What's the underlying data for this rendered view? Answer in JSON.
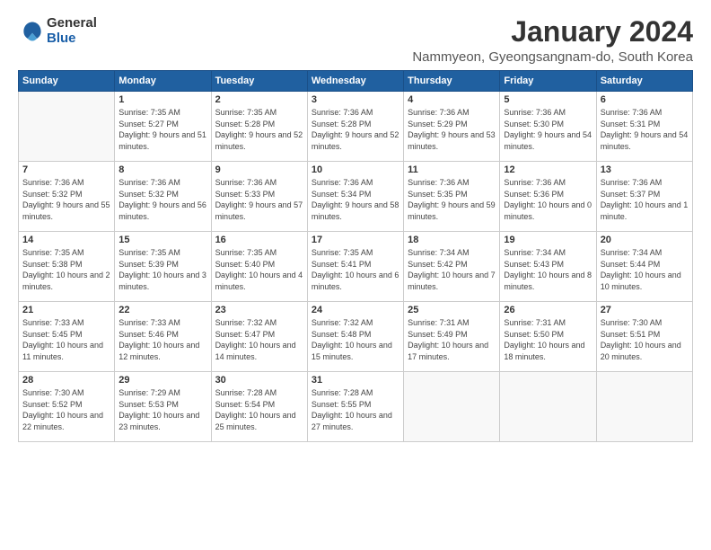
{
  "logo": {
    "general": "General",
    "blue": "Blue"
  },
  "title": "January 2024",
  "location": "Nammyeon, Gyeongsangnam-do, South Korea",
  "days_of_week": [
    "Sunday",
    "Monday",
    "Tuesday",
    "Wednesday",
    "Thursday",
    "Friday",
    "Saturday"
  ],
  "weeks": [
    [
      {
        "day": "",
        "sunrise": "",
        "sunset": "",
        "daylight": ""
      },
      {
        "day": "1",
        "sunrise": "Sunrise: 7:35 AM",
        "sunset": "Sunset: 5:27 PM",
        "daylight": "Daylight: 9 hours and 51 minutes."
      },
      {
        "day": "2",
        "sunrise": "Sunrise: 7:35 AM",
        "sunset": "Sunset: 5:28 PM",
        "daylight": "Daylight: 9 hours and 52 minutes."
      },
      {
        "day": "3",
        "sunrise": "Sunrise: 7:36 AM",
        "sunset": "Sunset: 5:28 PM",
        "daylight": "Daylight: 9 hours and 52 minutes."
      },
      {
        "day": "4",
        "sunrise": "Sunrise: 7:36 AM",
        "sunset": "Sunset: 5:29 PM",
        "daylight": "Daylight: 9 hours and 53 minutes."
      },
      {
        "day": "5",
        "sunrise": "Sunrise: 7:36 AM",
        "sunset": "Sunset: 5:30 PM",
        "daylight": "Daylight: 9 hours and 54 minutes."
      },
      {
        "day": "6",
        "sunrise": "Sunrise: 7:36 AM",
        "sunset": "Sunset: 5:31 PM",
        "daylight": "Daylight: 9 hours and 54 minutes."
      }
    ],
    [
      {
        "day": "7",
        "sunrise": "Sunrise: 7:36 AM",
        "sunset": "Sunset: 5:32 PM",
        "daylight": "Daylight: 9 hours and 55 minutes."
      },
      {
        "day": "8",
        "sunrise": "Sunrise: 7:36 AM",
        "sunset": "Sunset: 5:32 PM",
        "daylight": "Daylight: 9 hours and 56 minutes."
      },
      {
        "day": "9",
        "sunrise": "Sunrise: 7:36 AM",
        "sunset": "Sunset: 5:33 PM",
        "daylight": "Daylight: 9 hours and 57 minutes."
      },
      {
        "day": "10",
        "sunrise": "Sunrise: 7:36 AM",
        "sunset": "Sunset: 5:34 PM",
        "daylight": "Daylight: 9 hours and 58 minutes."
      },
      {
        "day": "11",
        "sunrise": "Sunrise: 7:36 AM",
        "sunset": "Sunset: 5:35 PM",
        "daylight": "Daylight: 9 hours and 59 minutes."
      },
      {
        "day": "12",
        "sunrise": "Sunrise: 7:36 AM",
        "sunset": "Sunset: 5:36 PM",
        "daylight": "Daylight: 10 hours and 0 minutes."
      },
      {
        "day": "13",
        "sunrise": "Sunrise: 7:36 AM",
        "sunset": "Sunset: 5:37 PM",
        "daylight": "Daylight: 10 hours and 1 minute."
      }
    ],
    [
      {
        "day": "14",
        "sunrise": "Sunrise: 7:35 AM",
        "sunset": "Sunset: 5:38 PM",
        "daylight": "Daylight: 10 hours and 2 minutes."
      },
      {
        "day": "15",
        "sunrise": "Sunrise: 7:35 AM",
        "sunset": "Sunset: 5:39 PM",
        "daylight": "Daylight: 10 hours and 3 minutes."
      },
      {
        "day": "16",
        "sunrise": "Sunrise: 7:35 AM",
        "sunset": "Sunset: 5:40 PM",
        "daylight": "Daylight: 10 hours and 4 minutes."
      },
      {
        "day": "17",
        "sunrise": "Sunrise: 7:35 AM",
        "sunset": "Sunset: 5:41 PM",
        "daylight": "Daylight: 10 hours and 6 minutes."
      },
      {
        "day": "18",
        "sunrise": "Sunrise: 7:34 AM",
        "sunset": "Sunset: 5:42 PM",
        "daylight": "Daylight: 10 hours and 7 minutes."
      },
      {
        "day": "19",
        "sunrise": "Sunrise: 7:34 AM",
        "sunset": "Sunset: 5:43 PM",
        "daylight": "Daylight: 10 hours and 8 minutes."
      },
      {
        "day": "20",
        "sunrise": "Sunrise: 7:34 AM",
        "sunset": "Sunset: 5:44 PM",
        "daylight": "Daylight: 10 hours and 10 minutes."
      }
    ],
    [
      {
        "day": "21",
        "sunrise": "Sunrise: 7:33 AM",
        "sunset": "Sunset: 5:45 PM",
        "daylight": "Daylight: 10 hours and 11 minutes."
      },
      {
        "day": "22",
        "sunrise": "Sunrise: 7:33 AM",
        "sunset": "Sunset: 5:46 PM",
        "daylight": "Daylight: 10 hours and 12 minutes."
      },
      {
        "day": "23",
        "sunrise": "Sunrise: 7:32 AM",
        "sunset": "Sunset: 5:47 PM",
        "daylight": "Daylight: 10 hours and 14 minutes."
      },
      {
        "day": "24",
        "sunrise": "Sunrise: 7:32 AM",
        "sunset": "Sunset: 5:48 PM",
        "daylight": "Daylight: 10 hours and 15 minutes."
      },
      {
        "day": "25",
        "sunrise": "Sunrise: 7:31 AM",
        "sunset": "Sunset: 5:49 PM",
        "daylight": "Daylight: 10 hours and 17 minutes."
      },
      {
        "day": "26",
        "sunrise": "Sunrise: 7:31 AM",
        "sunset": "Sunset: 5:50 PM",
        "daylight": "Daylight: 10 hours and 18 minutes."
      },
      {
        "day": "27",
        "sunrise": "Sunrise: 7:30 AM",
        "sunset": "Sunset: 5:51 PM",
        "daylight": "Daylight: 10 hours and 20 minutes."
      }
    ],
    [
      {
        "day": "28",
        "sunrise": "Sunrise: 7:30 AM",
        "sunset": "Sunset: 5:52 PM",
        "daylight": "Daylight: 10 hours and 22 minutes."
      },
      {
        "day": "29",
        "sunrise": "Sunrise: 7:29 AM",
        "sunset": "Sunset: 5:53 PM",
        "daylight": "Daylight: 10 hours and 23 minutes."
      },
      {
        "day": "30",
        "sunrise": "Sunrise: 7:28 AM",
        "sunset": "Sunset: 5:54 PM",
        "daylight": "Daylight: 10 hours and 25 minutes."
      },
      {
        "day": "31",
        "sunrise": "Sunrise: 7:28 AM",
        "sunset": "Sunset: 5:55 PM",
        "daylight": "Daylight: 10 hours and 27 minutes."
      },
      {
        "day": "",
        "sunrise": "",
        "sunset": "",
        "daylight": ""
      },
      {
        "day": "",
        "sunrise": "",
        "sunset": "",
        "daylight": ""
      },
      {
        "day": "",
        "sunrise": "",
        "sunset": "",
        "daylight": ""
      }
    ]
  ]
}
